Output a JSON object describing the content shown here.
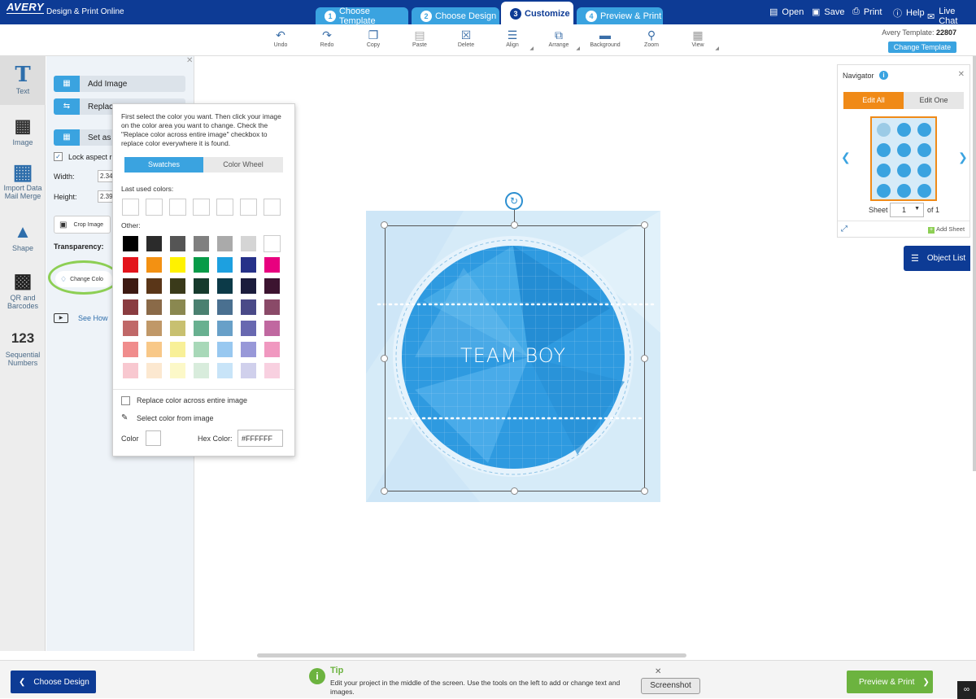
{
  "brand": {
    "logo": "AVERY",
    "app_name": "Design & Print Online"
  },
  "steps": [
    {
      "num": "1",
      "label": "Choose Template"
    },
    {
      "num": "2",
      "label": "Choose Design"
    },
    {
      "num": "3",
      "label": "Customize"
    },
    {
      "num": "4",
      "label": "Preview & Print"
    }
  ],
  "top_actions": {
    "open": "Open",
    "save": "Save",
    "print": "Print",
    "help": "Help",
    "live_chat": "Live Chat"
  },
  "toolbar": {
    "undo": "Undo",
    "redo": "Redo",
    "copy": "Copy",
    "paste": "Paste",
    "delete": "Delete",
    "align": "Align",
    "arrange": "Arrange",
    "background": "Background",
    "zoom": "Zoom",
    "view": "View",
    "template_label": "Avery Template:",
    "template_number": "22807",
    "change_template": "Change Template"
  },
  "left_nav": {
    "text": "Text",
    "image": "Image",
    "import_data_1": "Import Data",
    "import_data_2": "Mail Merge",
    "shape": "Shape",
    "qr_1": "QR and",
    "qr_2": "Barcodes",
    "seq_icon": "123",
    "seq_1": "Sequential",
    "seq_2": "Numbers"
  },
  "panel": {
    "add_image": "Add Image",
    "replace": "Replac",
    "set_as": "Set as",
    "lock_aspect": "Lock aspect r",
    "width_label": "Width:",
    "width_value": "2.34",
    "height_label": "Height:",
    "height_value": "2.39",
    "crop_image": "Crop Image",
    "transparency": "Transparency:",
    "change_color": "Change Colo",
    "see_how": "See How"
  },
  "color_popup": {
    "instructions": "First select the color you want. Then click your image on the color area you want to change. Check the \"Replace color across entire image\" checkbox to replace color everywhere it is found.",
    "tab_swatches": "Swatches",
    "tab_color_wheel": "Color Wheel",
    "last_used_label": "Last used colors:",
    "other_label": "Other:",
    "last_used": [
      "#ffffff",
      "#ffffff",
      "#ffffff",
      "#ffffff",
      "#ffffff",
      "#ffffff",
      "#ffffff"
    ],
    "swatches": [
      [
        "#000000",
        "#2b2b2b",
        "#555555",
        "#808080",
        "#aaaaaa",
        "#d5d5d5",
        "#ffffff"
      ],
      [
        "#e3141c",
        "#f39112",
        "#fff200",
        "#079b48",
        "#1da0e0",
        "#263189",
        "#e8007f"
      ],
      [
        "#3d1a12",
        "#5a3618",
        "#3a3a1a",
        "#163a2c",
        "#0c3a48",
        "#1b1c3c",
        "#3c1430"
      ],
      [
        "#8a3c40",
        "#8a6a48",
        "#8a8850",
        "#4a8070",
        "#4a7090",
        "#4a4a88",
        "#8a4a68"
      ],
      [
        "#c06868",
        "#c09868",
        "#c8c070",
        "#68b090",
        "#68a0c8",
        "#6868b0",
        "#c068a0"
      ],
      [
        "#f08c8c",
        "#f8c888",
        "#f8f098",
        "#a8d8b8",
        "#98c8f0",
        "#9898d8",
        "#f098c0"
      ],
      [
        "#f8c8d0",
        "#fce8d0",
        "#fcf8c8",
        "#d8ecdc",
        "#c8e4f8",
        "#d0d0ec",
        "#f8d0e0"
      ]
    ],
    "replace_label": "Replace color across entire image",
    "pick_label": "Select color from image",
    "color_label": "Color",
    "hex_label": "Hex Color:",
    "hex_value": "#FFFFFF"
  },
  "canvas": {
    "design_text": "TEAM BOY"
  },
  "navigator": {
    "title": "Navigator",
    "edit_all": "Edit All",
    "edit_one": "Edit One",
    "sheet_label": "Sheet",
    "sheet_value": "1",
    "sheet_of": "of 1",
    "add_sheet": "Add Sheet"
  },
  "object_list": "Object List",
  "bottom": {
    "choose_design": "Choose Design",
    "preview_print": "Preview & Print",
    "tip_title": "Tip",
    "tip_text": "Edit your project in the middle of the screen. Use the tools on the left to add or change text and images.",
    "screenshot": "Screenshot"
  },
  "colors": {
    "brand_navy": "#0d3b95",
    "accent_blue": "#3aa3e0",
    "orange": "#f08a17",
    "green": "#6cb33f"
  }
}
